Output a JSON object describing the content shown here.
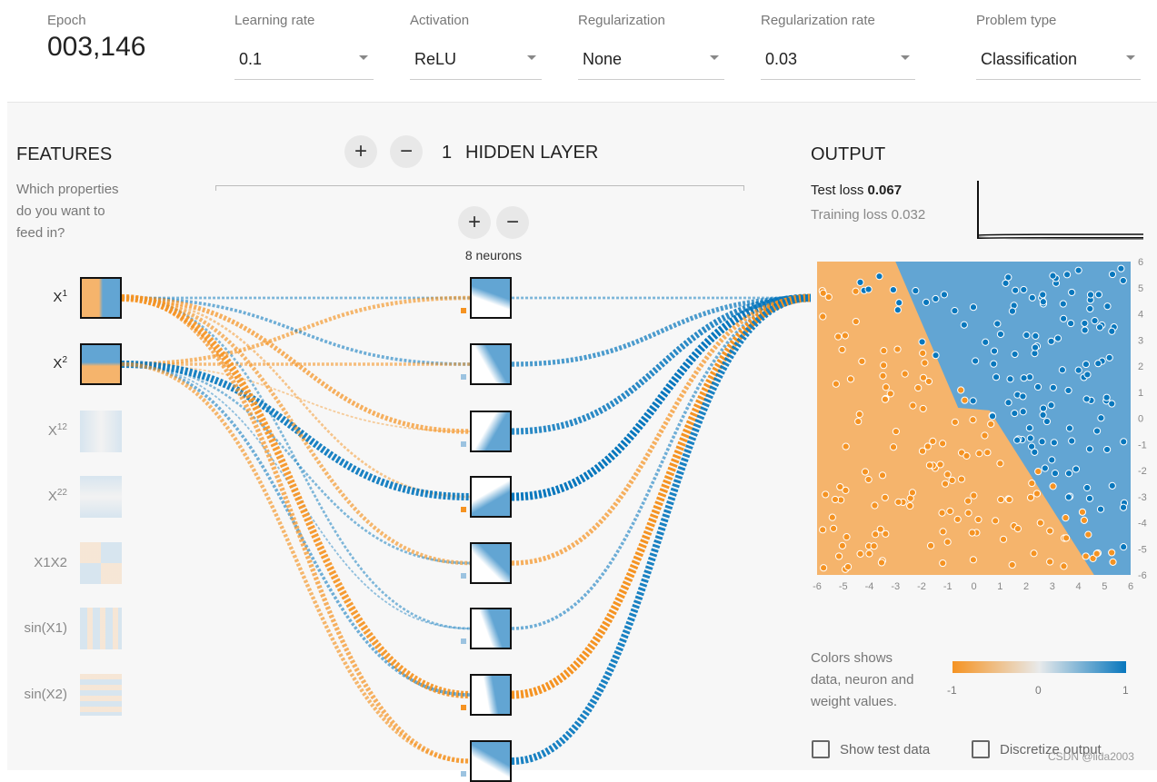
{
  "header": {
    "epoch_label": "Epoch",
    "epoch_value": "003,146",
    "controls": [
      {
        "label": "Learning rate",
        "value": "0.1"
      },
      {
        "label": "Activation",
        "value": "ReLU"
      },
      {
        "label": "Regularization",
        "value": "None"
      },
      {
        "label": "Regularization rate",
        "value": "0.03"
      },
      {
        "label": "Problem type",
        "value": "Classification"
      }
    ]
  },
  "features": {
    "title": "FEATURES",
    "subtitle": [
      "Which properties",
      "do you want to",
      "feed in?"
    ],
    "items": [
      {
        "label": "X1",
        "base": "X",
        "sup": "1",
        "active": true
      },
      {
        "label": "X2",
        "base": "X",
        "sup": "2",
        "active": true
      },
      {
        "label": "X1^2",
        "base": "X",
        "sup": "12",
        "active": false
      },
      {
        "label": "X2^2",
        "base": "X",
        "sup": "22",
        "active": false
      },
      {
        "label": "X1X2",
        "base": "X1X2",
        "sup": "",
        "active": false
      },
      {
        "label": "sin(X1)",
        "base": "sin(X1)",
        "sup": "",
        "active": false
      },
      {
        "label": "sin(X2)",
        "base": "sin(X2)",
        "sup": "",
        "active": false
      }
    ]
  },
  "network": {
    "add_layer": "+",
    "remove_layer": "−",
    "layer_count": "1",
    "layer_label": "HIDDEN LAYER",
    "add_neuron": "+",
    "remove_neuron": "−",
    "neurons_label": "8 neurons",
    "weights_in": [
      [
        0.3,
        -0.5
      ],
      [
        0.4,
        -0.4
      ],
      [
        -0.6,
        -0.2
      ],
      [
        -0.3,
        0.9
      ],
      [
        -0.5,
        0.3
      ],
      [
        0.3,
        0.2
      ],
      [
        -0.9,
        0.4
      ],
      [
        -0.6,
        -0.5
      ]
    ],
    "weights_out": [
      0.3,
      0.6,
      0.8,
      1.0,
      -0.6,
      0.4,
      -1.0,
      0.9
    ]
  },
  "output": {
    "title": "OUTPUT",
    "test_loss_label": "Test loss",
    "test_loss": "0.067",
    "training_loss_label": "Training loss",
    "training_loss": "0.032",
    "axis_ticks": [
      "-6",
      "-5",
      "-4",
      "-3",
      "-2",
      "-1",
      "0",
      "1",
      "2",
      "3",
      "4",
      "5",
      "6"
    ],
    "legend_text": [
      "Colors shows",
      "data, neuron and",
      "weight values."
    ],
    "legend_ticks": [
      "-1",
      "0",
      "1"
    ],
    "show_test_data": "Show test data",
    "discretize_output": "Discretize output"
  },
  "colors": {
    "orange": "#f59322",
    "blue": "#0877bd",
    "orange_bg": "#f5b46c",
    "blue_bg": "#62a5d3"
  },
  "watermark": "CSDN @lida2003"
}
